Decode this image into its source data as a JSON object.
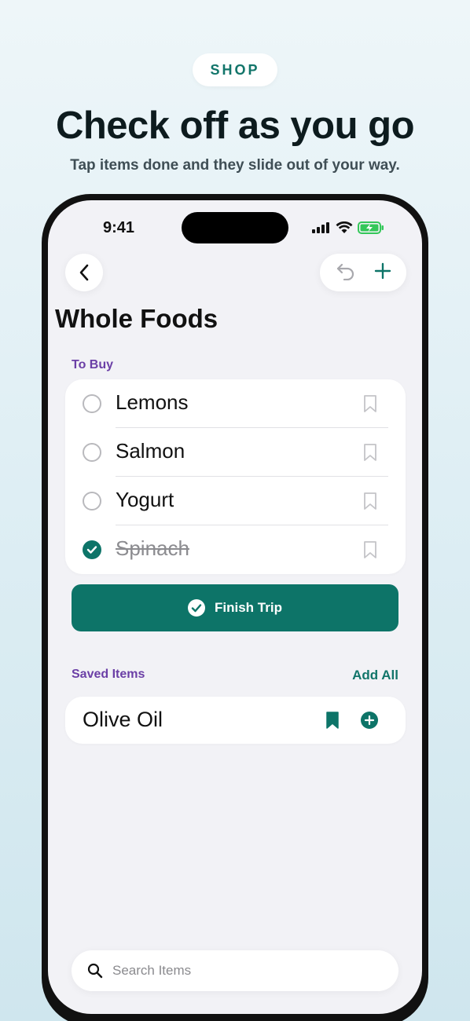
{
  "promo": {
    "tag": "SHOP",
    "headline": "Check off as you go",
    "subline": "Tap items done and they slide out of your way."
  },
  "status_bar": {
    "time": "9:41"
  },
  "nav": {
    "back_icon": "chevron-left-icon",
    "undo_icon": "undo-icon",
    "add_icon": "plus-icon"
  },
  "store": {
    "title": "Whole Foods"
  },
  "to_buy": {
    "label": "To Buy",
    "items": [
      {
        "name": "Lemons",
        "checked": false
      },
      {
        "name": "Salmon",
        "checked": false
      },
      {
        "name": "Yogurt",
        "checked": false
      },
      {
        "name": "Spinach",
        "checked": true
      }
    ]
  },
  "finish_button": {
    "label": "Finish Trip"
  },
  "saved": {
    "label": "Saved Items",
    "add_all": "Add All",
    "items": [
      {
        "name": "Olive Oil"
      }
    ]
  },
  "search": {
    "placeholder": "Search Items"
  },
  "colors": {
    "accent": "#0d7468",
    "section_label": "#6b3fa6",
    "background": "#f2f2f6"
  }
}
